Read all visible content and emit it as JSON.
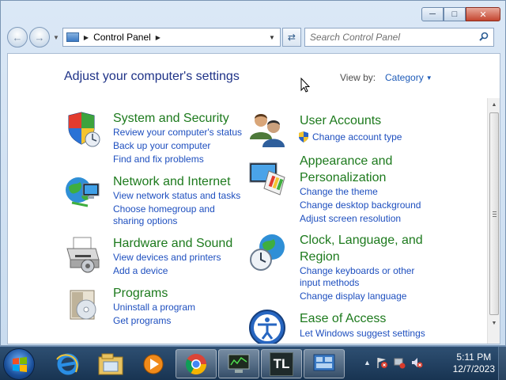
{
  "window": {
    "caption_buttons": {
      "minimize": "minimize-icon",
      "maximize": "maximize-icon",
      "close": "close-icon"
    }
  },
  "nav": {
    "address_path": [
      "Control Panel"
    ],
    "search_placeholder": "Search Control Panel"
  },
  "main": {
    "title": "Adjust your computer's settings",
    "view_by_label": "View by:",
    "view_by_value": "Category",
    "categories": [
      {
        "icon": "shield-icon",
        "heading": "System and Security",
        "links": [
          "Review your computer's status",
          "Back up your computer",
          "Find and fix problems"
        ]
      },
      {
        "icon": "network-globe-icon",
        "heading": "Network and Internet",
        "links": [
          "View network status and tasks",
          "Choose homegroup and",
          "sharing options"
        ]
      },
      {
        "icon": "printer-icon",
        "heading": "Hardware and Sound",
        "links": [
          "View devices and printers",
          "Add a device"
        ]
      },
      {
        "icon": "programs-box-icon",
        "heading": "Programs",
        "links": [
          "Uninstall a program",
          "Get programs"
        ]
      },
      {
        "icon": "users-icon",
        "heading": "User Accounts",
        "links": [
          "Change account type"
        ]
      },
      {
        "icon": "display-palette-icon",
        "heading_lines": [
          "Appearance and",
          "Personalization"
        ],
        "links": [
          "Change the theme",
          "Change desktop background",
          "Adjust screen resolution"
        ]
      },
      {
        "icon": "clock-globe-icon",
        "heading_lines": [
          "Clock, Language, and",
          "Region"
        ],
        "links": [
          "Change keyboards or other",
          "input methods",
          "Change display language"
        ]
      },
      {
        "icon": "ease-of-access-icon",
        "heading": "Ease of Access",
        "links": [
          "Let Windows suggest settings"
        ]
      }
    ]
  },
  "taskbar": {
    "items": [
      "start-orb-icon",
      "internet-explorer-icon",
      "windows-explorer-icon",
      "media-player-icon",
      "chrome-icon",
      "monitor-terminal-icon",
      "tl-app-icon",
      "control-panel-icon"
    ],
    "tl_label": "TL",
    "clock_time": "5:11 PM",
    "clock_date": "12/7/2023"
  },
  "colors": {
    "heading_green": "#1d7a1d",
    "link_blue": "#1e4fbf",
    "title_blue": "#1e3287"
  }
}
